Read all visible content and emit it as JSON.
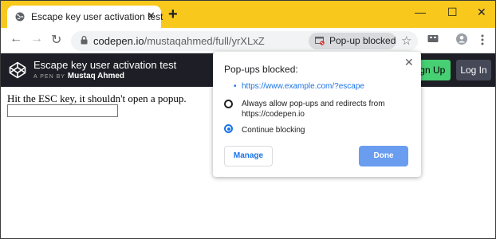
{
  "browser": {
    "tab": {
      "title": "Escape key user activation test",
      "favicon": "globe-icon",
      "close_glyph": "✕"
    },
    "newtab_glyph": "+",
    "window_controls": {
      "minimize": "—",
      "maximize": "☐",
      "close": "✕"
    },
    "nav": {
      "back": "←",
      "forward": "→",
      "reload": "↻"
    },
    "address": {
      "host": "codepen.io",
      "path": "/mustaqahmed/full/yrXLxZ"
    },
    "popup_chip_label": "Pop-up blocked",
    "star_glyph": "☆"
  },
  "codepen": {
    "title": "Escape key user activation test",
    "subtitle_prefix": "A PEN BY",
    "author": "Mustaq Ahmed",
    "signup_label": "Sign Up",
    "login_label": "Log In"
  },
  "content": {
    "text": "Hit the ESC key, it shouldn't open a popup.",
    "input_value": ""
  },
  "popup_bubble": {
    "title": "Pop-ups blocked:",
    "close_glyph": "✕",
    "bullet": "•",
    "blocked_url": "https://www.example.com/?escape",
    "option_allow": "Always allow pop-ups and redirects from https://codepen.io",
    "option_block": "Continue blocking",
    "selected_option": "block",
    "manage_label": "Manage",
    "done_label": "Done"
  },
  "colors": {
    "titlebar": "#f8c81c",
    "codepen_header": "#1e1f26",
    "signup": "#47cf73",
    "login": "#444857",
    "done": "#6a9df0",
    "link": "#1a73e8"
  }
}
